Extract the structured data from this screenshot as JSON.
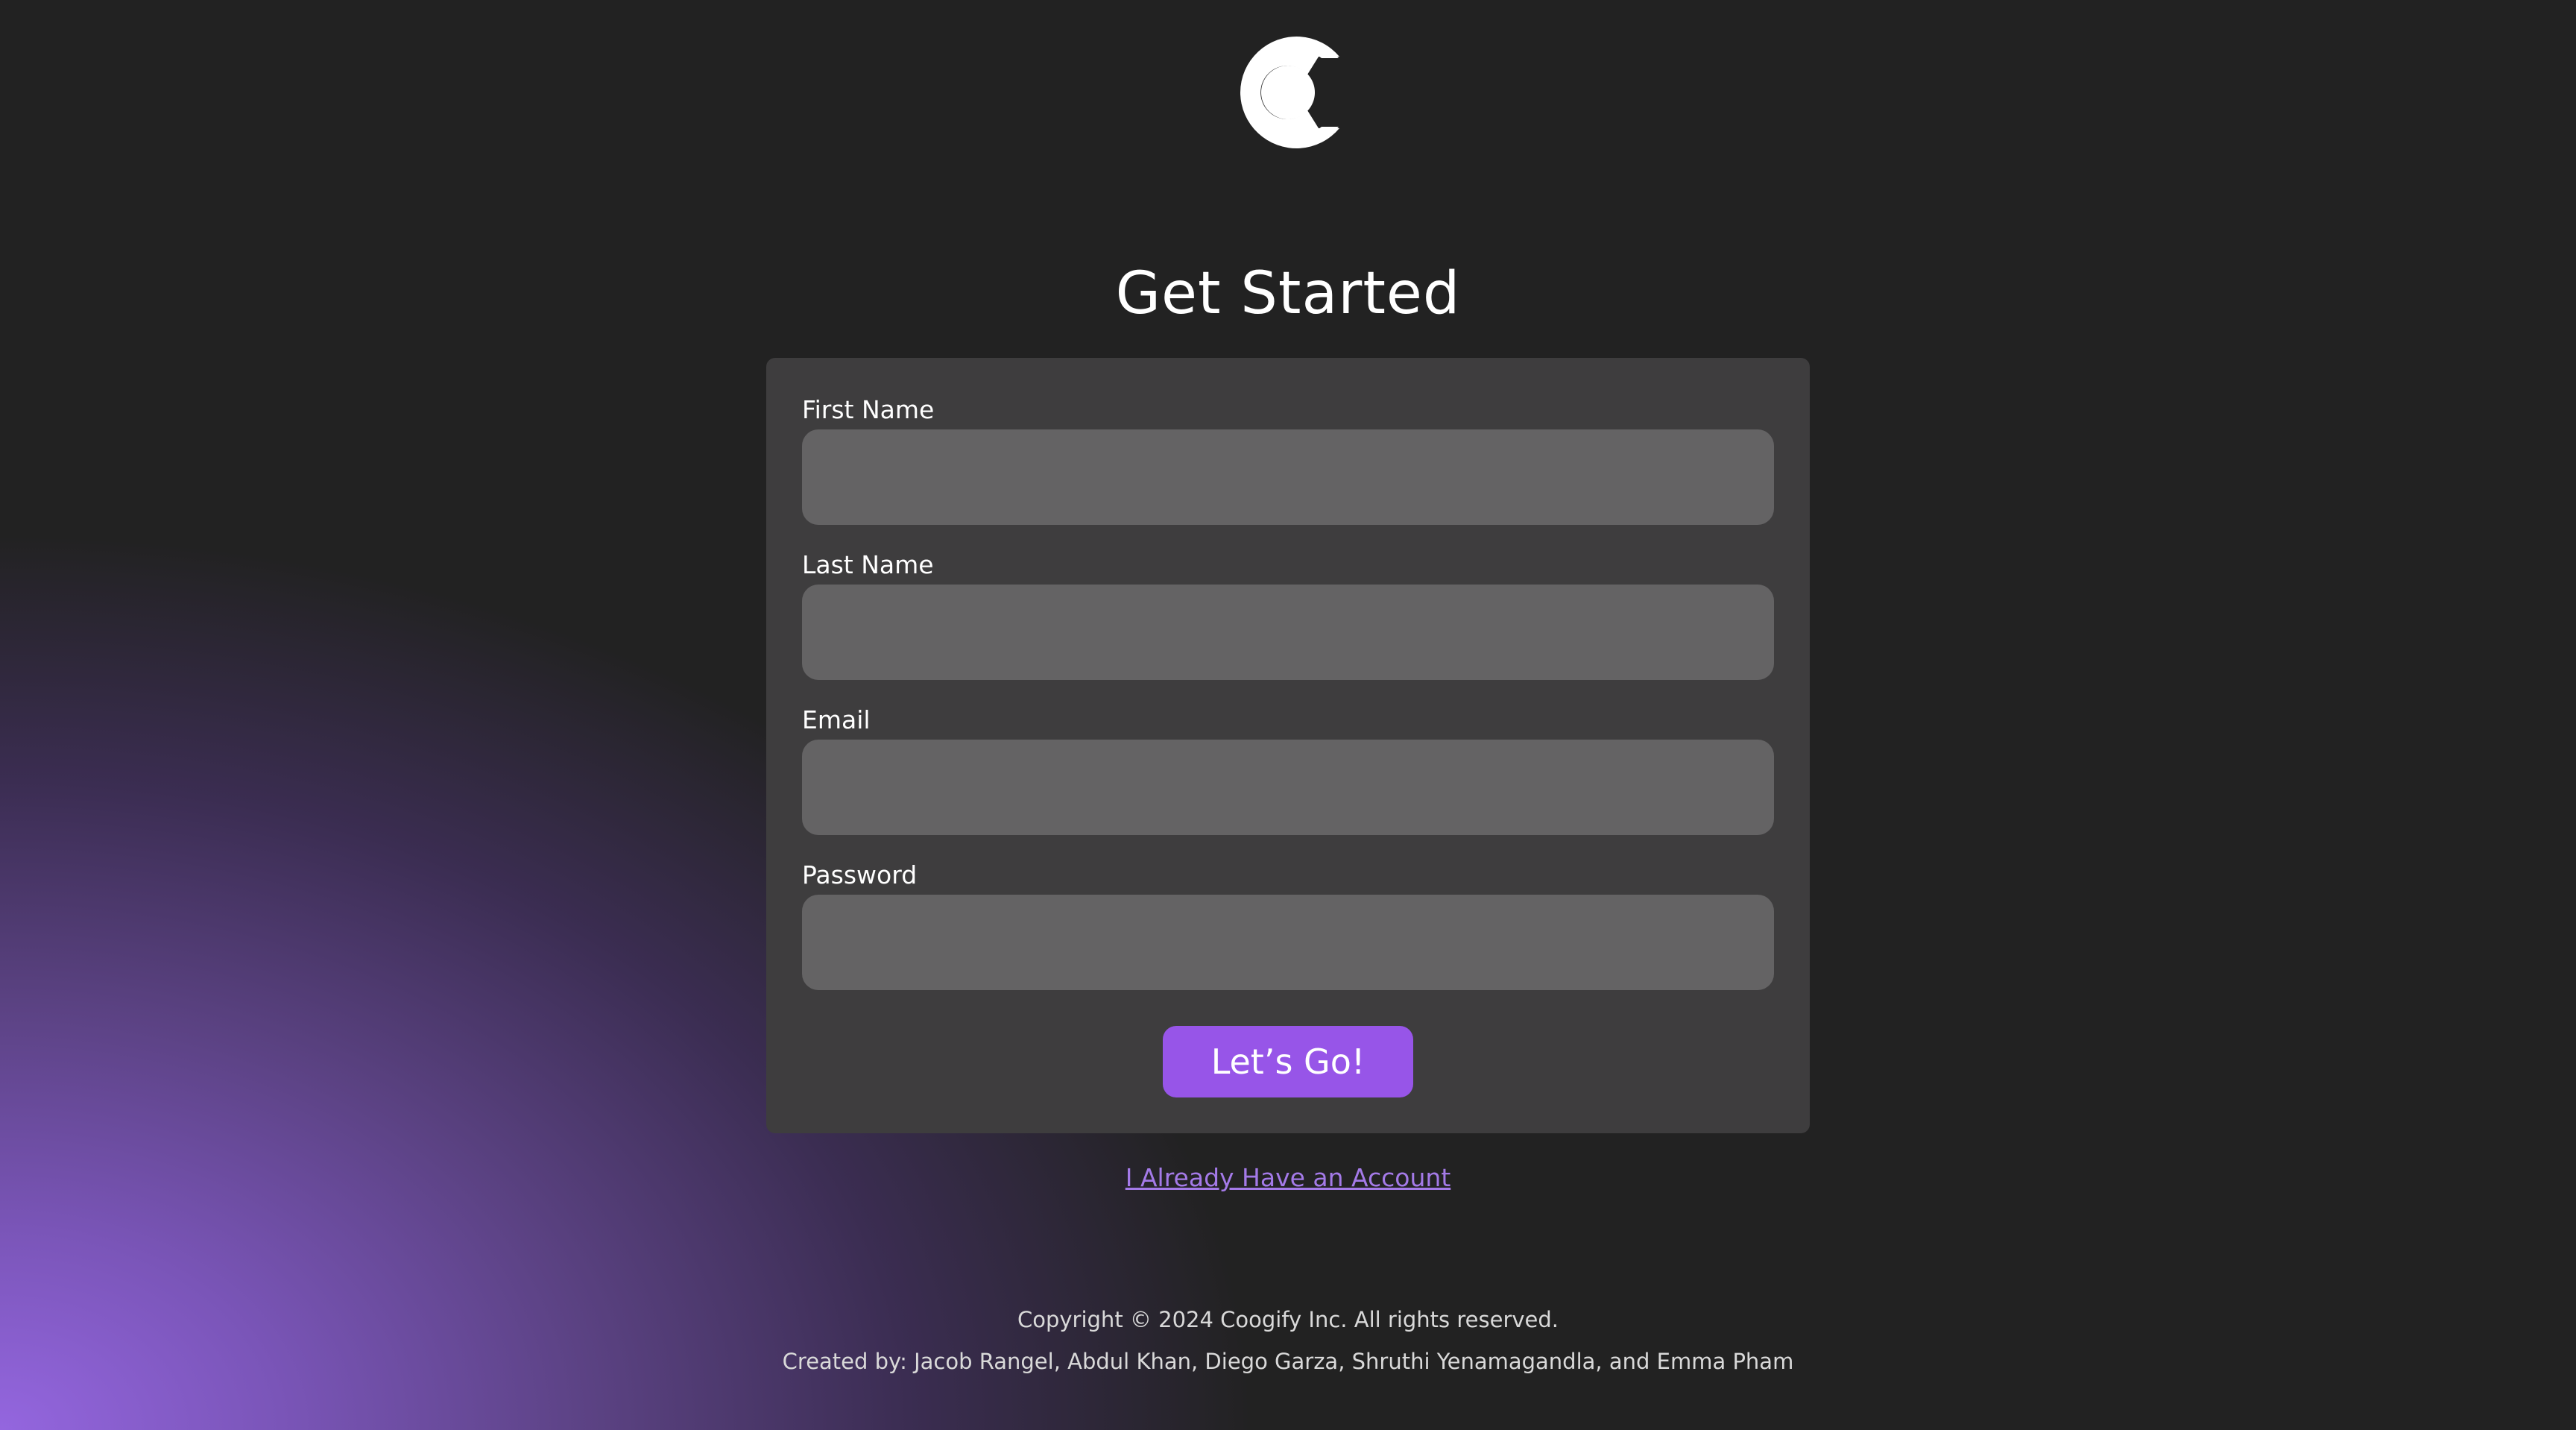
{
  "brand": {
    "logo_icon": "play-c-logo-icon",
    "accent_color": "#9755e8"
  },
  "page": {
    "title": "Get Started"
  },
  "form": {
    "fields": [
      {
        "label": "First Name",
        "value": "",
        "placeholder": ""
      },
      {
        "label": "Last Name",
        "value": "",
        "placeholder": ""
      },
      {
        "label": "Email",
        "value": "",
        "placeholder": ""
      },
      {
        "label": "Password",
        "value": "",
        "placeholder": ""
      }
    ],
    "submit_label": "Let’s Go!"
  },
  "links": {
    "existing_account": "I Already Have an Account"
  },
  "footer": {
    "copyright": "Copyright © 2024 Coogify Inc. All rights reserved.",
    "credits": "Created by: Jacob Rangel, Abdul Khan, Diego Garza, Shruthi Yenamagandla, and Emma Pham"
  }
}
